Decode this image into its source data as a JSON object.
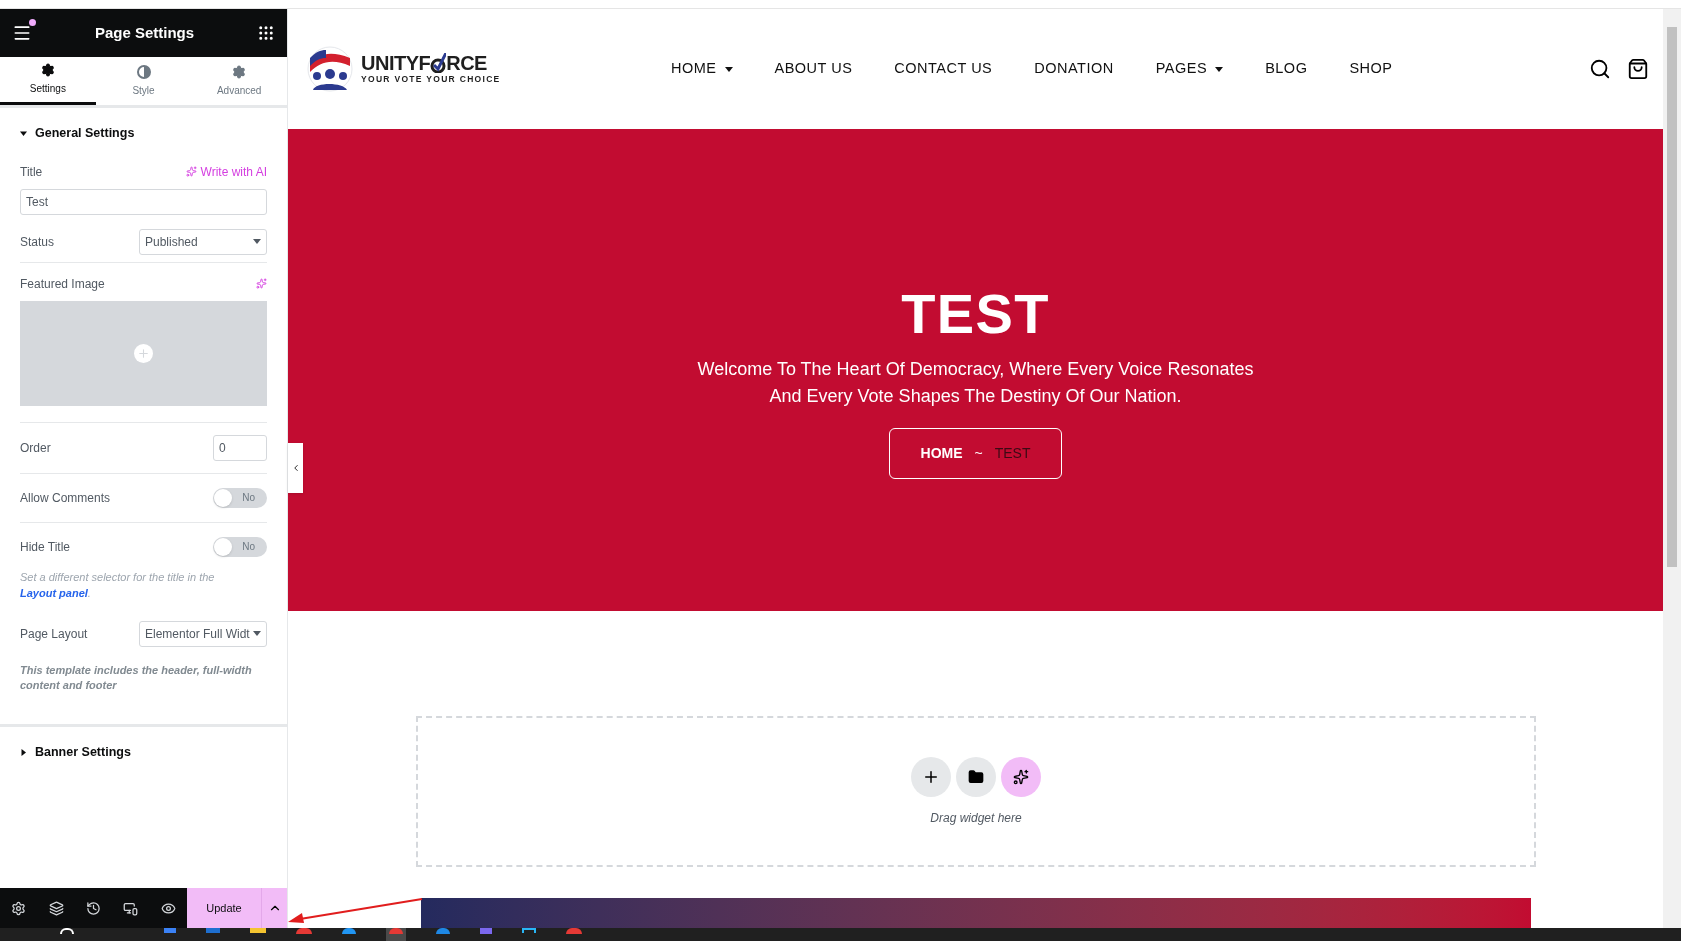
{
  "panel": {
    "title": "Page Settings",
    "notification_dot": true,
    "tabs": [
      {
        "label": "Settings",
        "selected": true,
        "kind": "gear"
      },
      {
        "label": "Style",
        "selected": false,
        "kind": "contrast"
      },
      {
        "label": "Advanced",
        "selected": false,
        "kind": "gear"
      }
    ],
    "sections": [
      {
        "title": "General Settings",
        "expanded": true,
        "fields": [
          {
            "kind": "text",
            "label": "Title",
            "ai_label": "Write with AI",
            "value": "Test"
          },
          {
            "kind": "select",
            "label": "Status",
            "value": "Published"
          },
          {
            "kind": "image",
            "label": "Featured Image"
          },
          {
            "kind": "number",
            "label": "Order",
            "value": "0"
          },
          {
            "kind": "toggle",
            "label": "Allow Comments",
            "on": false,
            "state_label": "No"
          },
          {
            "kind": "toggle",
            "label": "Hide Title",
            "on": false,
            "state_label": "No",
            "note": "Set a different selector for the title in the",
            "link": "Layout panel",
            "note_end": "."
          },
          {
            "kind": "select",
            "label": "Page Layout",
            "value": "Elementor Full Widt",
            "note": "This template includes the header, full-width content and footer"
          }
        ]
      },
      {
        "title": "Banner Settings",
        "expanded": false
      }
    ],
    "footer": {
      "update_label": "Update"
    }
  },
  "site": {
    "logo": {
      "brand_start": "UNITYF",
      "brand_end": "RCE",
      "tagline": "YOUR VOTE YOUR CHOICE"
    },
    "nav": [
      {
        "label": "HOME",
        "dropdown": true
      },
      {
        "label": "ABOUT US",
        "dropdown": false
      },
      {
        "label": "CONTACT US",
        "dropdown": false
      },
      {
        "label": "DONATION",
        "dropdown": false
      },
      {
        "label": "PAGES",
        "dropdown": true
      },
      {
        "label": "BLOG",
        "dropdown": false
      },
      {
        "label": "SHOP",
        "dropdown": false
      }
    ],
    "hero": {
      "title": "TEST",
      "subtitle_lines": [
        "Welcome To The Heart Of Democracy, Where Every Voice Resonates",
        "And Every Vote Shapes The Destiny Of Our Nation."
      ],
      "breadcrumb": {
        "home": "HOME",
        "separator": "~",
        "current": "TEST"
      }
    },
    "drop_area": {
      "hint": "Drag widget here"
    }
  }
}
